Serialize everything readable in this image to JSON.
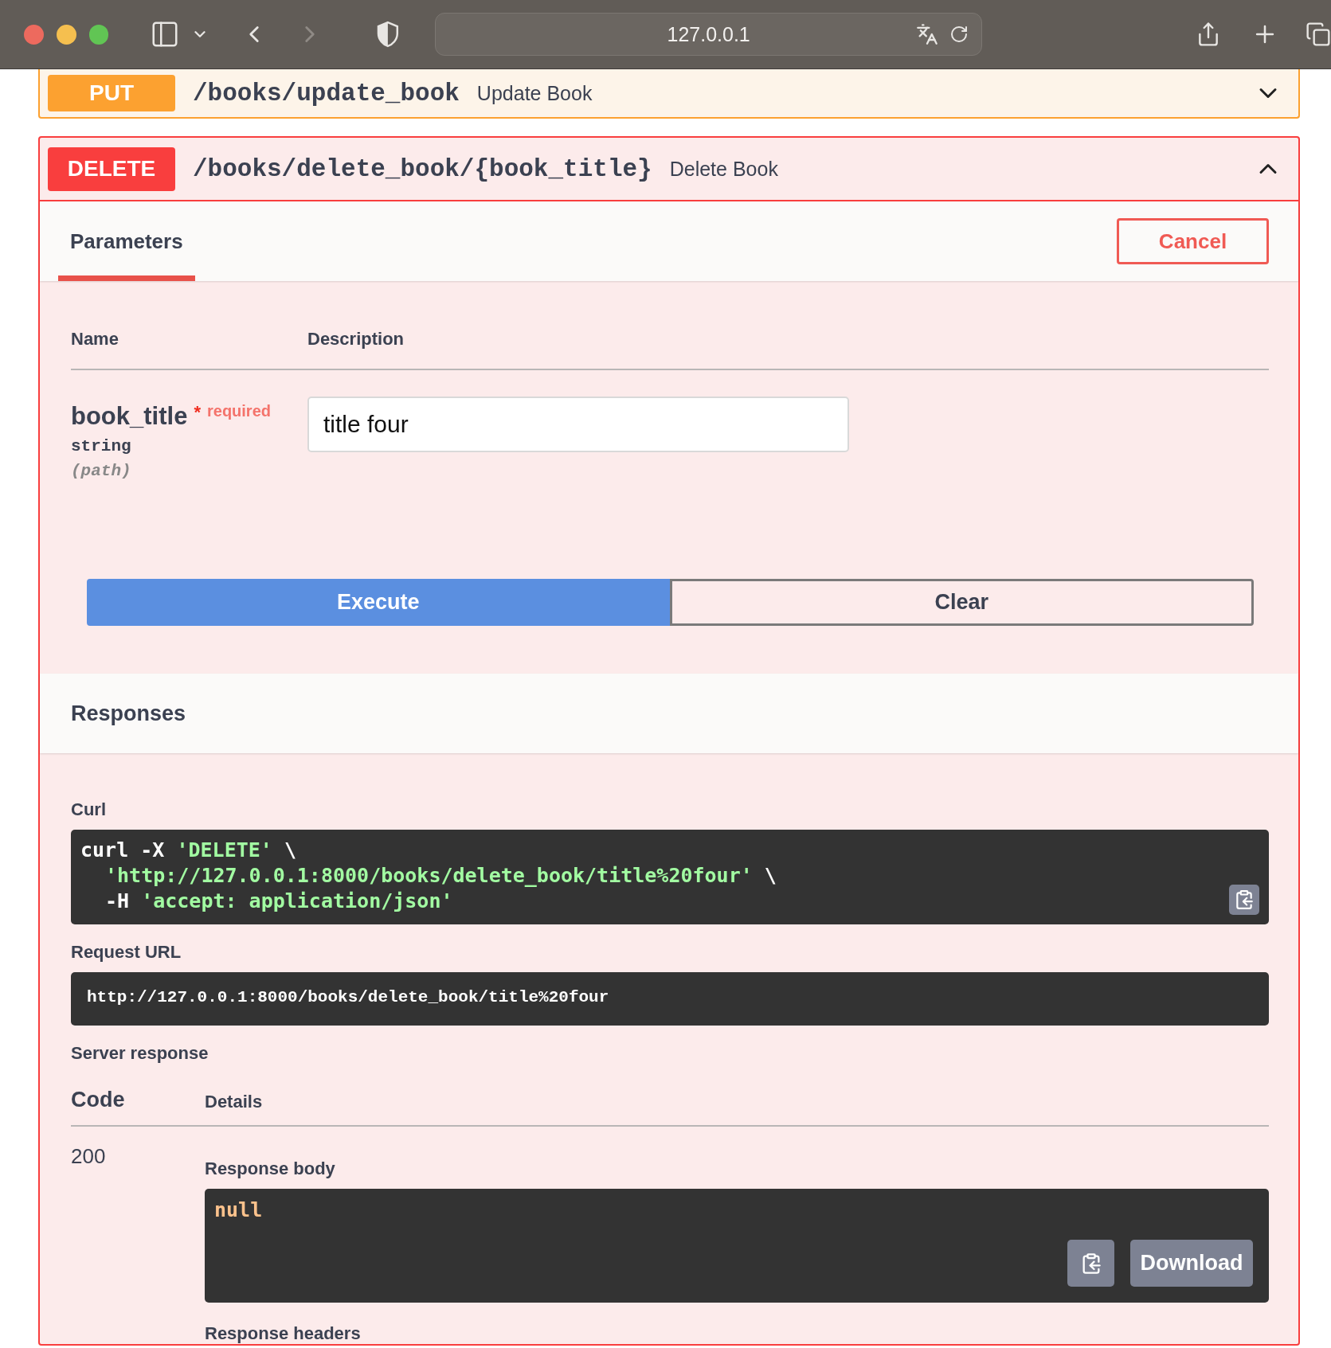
{
  "browser": {
    "url": "127.0.0.1"
  },
  "operations": [
    {
      "method": "PUT",
      "color": "#fca130",
      "path": "/books/update_book",
      "summary": "Update Book",
      "expanded": false
    },
    {
      "method": "DELETE",
      "color": "#f93e3e",
      "path": "/books/delete_book/{book_title}",
      "summary": "Delete Book",
      "expanded": true,
      "tabs": [
        {
          "label": "Parameters",
          "selected": true
        }
      ],
      "cancel_button": "Cancel",
      "parameters": {
        "columns": [
          "Name",
          "Description"
        ],
        "rows": [
          {
            "name": "book_title",
            "required_mark": "*",
            "required_label": "required",
            "type": "string",
            "location": "(path)",
            "value": "title four"
          }
        ]
      },
      "actions": [
        {
          "label": "Execute",
          "kind": "primary"
        },
        {
          "label": "Clear",
          "kind": "secondary"
        }
      ],
      "responses": {
        "title": "Responses",
        "curl_label": "Curl",
        "curl_lines": [
          [
            {
              "text": "curl -X ",
              "kind": "plain"
            },
            {
              "text": "'DELETE'",
              "kind": "string"
            },
            {
              "text": " \\",
              "kind": "plain"
            }
          ],
          [
            {
              "text": "'http://127.0.0.1:8000/books/delete_book/title%20four'",
              "kind": "string"
            },
            {
              "text": " \\",
              "kind": "plain"
            }
          ],
          [
            {
              "text": "-H ",
              "kind": "plain"
            },
            {
              "text": "'accept: application/json'",
              "kind": "string"
            }
          ]
        ],
        "request_url_label": "Request URL",
        "request_url": "http://127.0.0.1:8000/books/delete_book/title%20four",
        "server_response_label": "Server response",
        "columns": [
          "Code",
          "Details"
        ],
        "code": "200",
        "body_label": "Response body",
        "body": "null",
        "download_button": "Download",
        "headers_label": "Response headers"
      }
    }
  ]
}
